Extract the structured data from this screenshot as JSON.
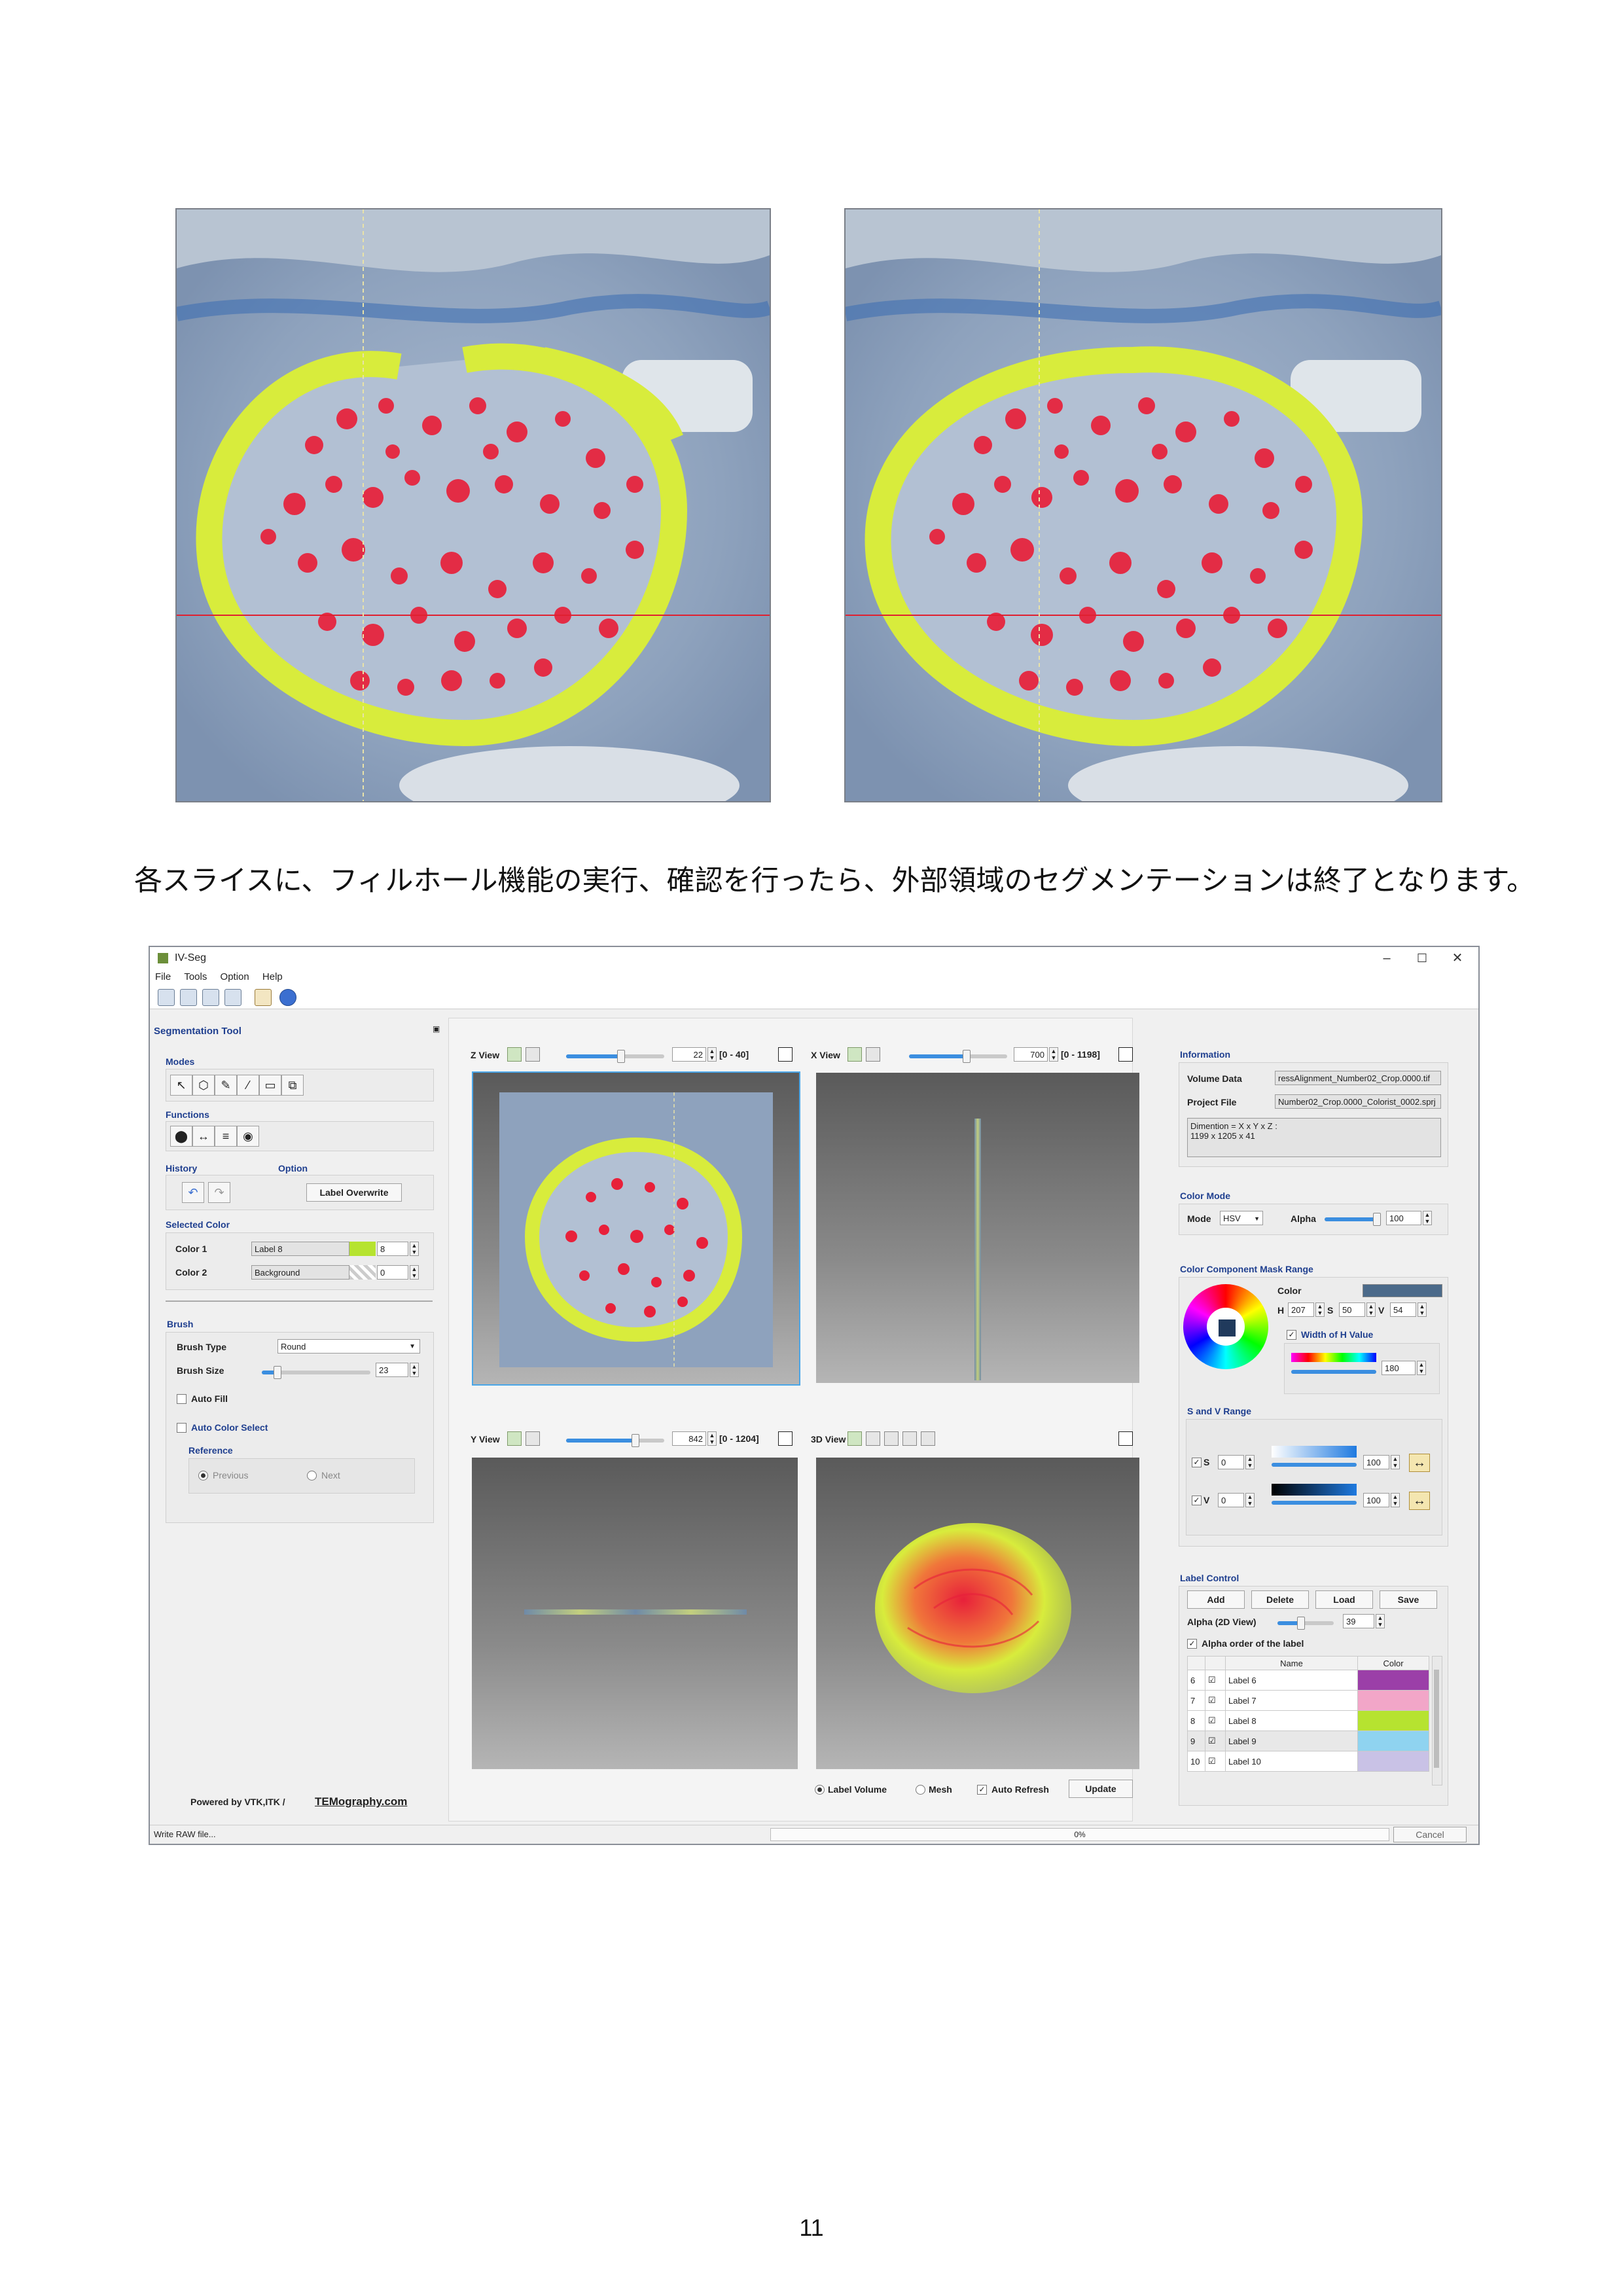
{
  "caption": "各スライスに、フィルホール機能の実行、確認を行ったら、外部領域のセグメンテーションは終了となります。",
  "page_number": "11",
  "colors": {
    "label_fill": "#d8ec3c",
    "nucleus": "#e8203a",
    "tissue_bg": "#8ea2bd",
    "accent_blue": "#1f3f8f",
    "slider_blue": "#3b8ee0"
  },
  "app": {
    "window_title": "IV-Seg",
    "menu": [
      "File",
      "Tools",
      "Option",
      "Help"
    ],
    "panel_title": "Segmentation Tool",
    "modes_label": "Modes",
    "functions_label": "Functions",
    "history_label": "History",
    "option_label": "Option",
    "label_overwrite": "Label Overwrite",
    "selected_color_label": "Selected Color",
    "color1_label": "Color 1",
    "color1_name": "Label 8",
    "color1_value": "8",
    "color2_label": "Color 2",
    "color2_name": "Background",
    "color2_value": "0",
    "brush_label": "Brush",
    "brush_type_label": "Brush Type",
    "brush_type_value": "Round",
    "brush_size_label": "Brush Size",
    "brush_size_value": "23",
    "auto_fill": "Auto Fill",
    "auto_color_select": "Auto Color Select",
    "reference_label": "Reference",
    "ref_previous": "Previous",
    "ref_next": "Next",
    "powered_by": "Powered by VTK,ITK /",
    "powered_brand": "TEMography.com",
    "z_view": {
      "label": "Z View",
      "value": "22",
      "range": "[0 - 40]",
      "level": 0.55
    },
    "x_view": {
      "label": "X View",
      "value": "700",
      "range": "[0 - 1198]",
      "level": 0.58
    },
    "y_view": {
      "label": "Y View",
      "value": "842",
      "range": "[0 - 1204]",
      "level": 0.7
    },
    "three_d_view": {
      "label": "3D View"
    },
    "render_options": {
      "label_volume": "Label Volume",
      "mesh": "Mesh",
      "auto_refresh": "Auto Refresh",
      "update": "Update"
    },
    "information_label": "Information",
    "volume_data_label": "Volume Data",
    "volume_data_value": "ressAlignment_Number02_Crop.0000.tif",
    "project_file_label": "Project File",
    "project_file_value": "Number02_Crop.0000_Colorist_0002.sprj",
    "dimension_line1": "Dimention = X x Y x Z :",
    "dimension_line2": "1199 x 1205 x 41",
    "color_mode_label": "Color Mode",
    "mode_label": "Mode",
    "mode_value": "HSV",
    "alpha_label": "Alpha",
    "alpha_value": "100",
    "mask_range_label": "Color Component Mask Range",
    "color_word": "Color",
    "swatch_color": "#4b6a8a",
    "h_label": "H",
    "h_value": "207",
    "s_label": "S",
    "s_value": "50",
    "v_label": "V",
    "v_value": "54",
    "width_h_label": "Width of H Value",
    "width_h_value": "180",
    "sv_range_label": "S and V Range",
    "s_row": {
      "label": "S",
      "min": "0",
      "max": "100"
    },
    "v_row": {
      "label": "V",
      "min": "0",
      "max": "100"
    },
    "label_control_label": "Label Control",
    "add": "Add",
    "delete": "Delete",
    "load": "Load",
    "save": "Save",
    "alpha2d_label": "Alpha (2D View)",
    "alpha2d_value": "39",
    "alpha_order_label": "Alpha order of the label",
    "table_headers": [
      "Name",
      "Color"
    ],
    "labels": [
      {
        "idx": "6",
        "name": "Label 6",
        "color": "#9b3fa8"
      },
      {
        "idx": "7",
        "name": "Label 7",
        "color": "#f2a6c8"
      },
      {
        "idx": "8",
        "name": "Label 8",
        "color": "#b6e330"
      },
      {
        "idx": "9",
        "name": "Label 9",
        "color": "#8fd3f0"
      },
      {
        "idx": "10",
        "name": "Label 10",
        "color": "#c9c2e6"
      }
    ],
    "status_text": "Write RAW file...",
    "progress_text": "0%",
    "cancel": "Cancel"
  }
}
